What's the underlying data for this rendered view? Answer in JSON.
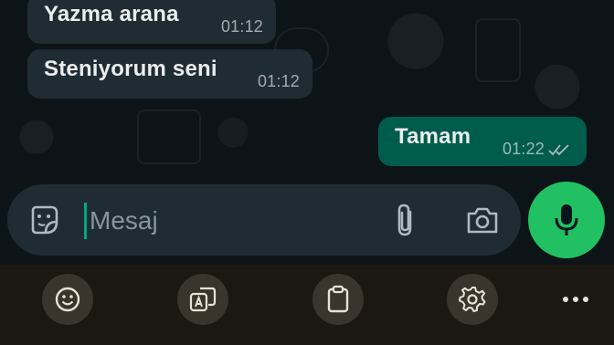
{
  "messages": [
    {
      "text": "Yazma arana",
      "time": "01:12",
      "direction": "incoming"
    },
    {
      "text": "Steniyorum seni",
      "time": "01:12",
      "direction": "incoming"
    },
    {
      "text": "Tamam",
      "time": "01:22",
      "direction": "outgoing",
      "status": "read-ticks"
    }
  ],
  "composer": {
    "placeholder": "Mesaj",
    "icons": [
      "sticker-icon",
      "attach-icon",
      "camera-icon"
    ]
  },
  "send": {
    "icon": "microphone-icon",
    "color": "#21c063"
  },
  "keyboard_toolbar": {
    "icons": [
      "emoji-icon",
      "translate-icon",
      "clipboard-icon",
      "settings-icon",
      "more-icon"
    ]
  },
  "colors": {
    "incoming_bubble": "#202c33",
    "outgoing_bubble": "#005c4b",
    "accent": "#00a884"
  }
}
